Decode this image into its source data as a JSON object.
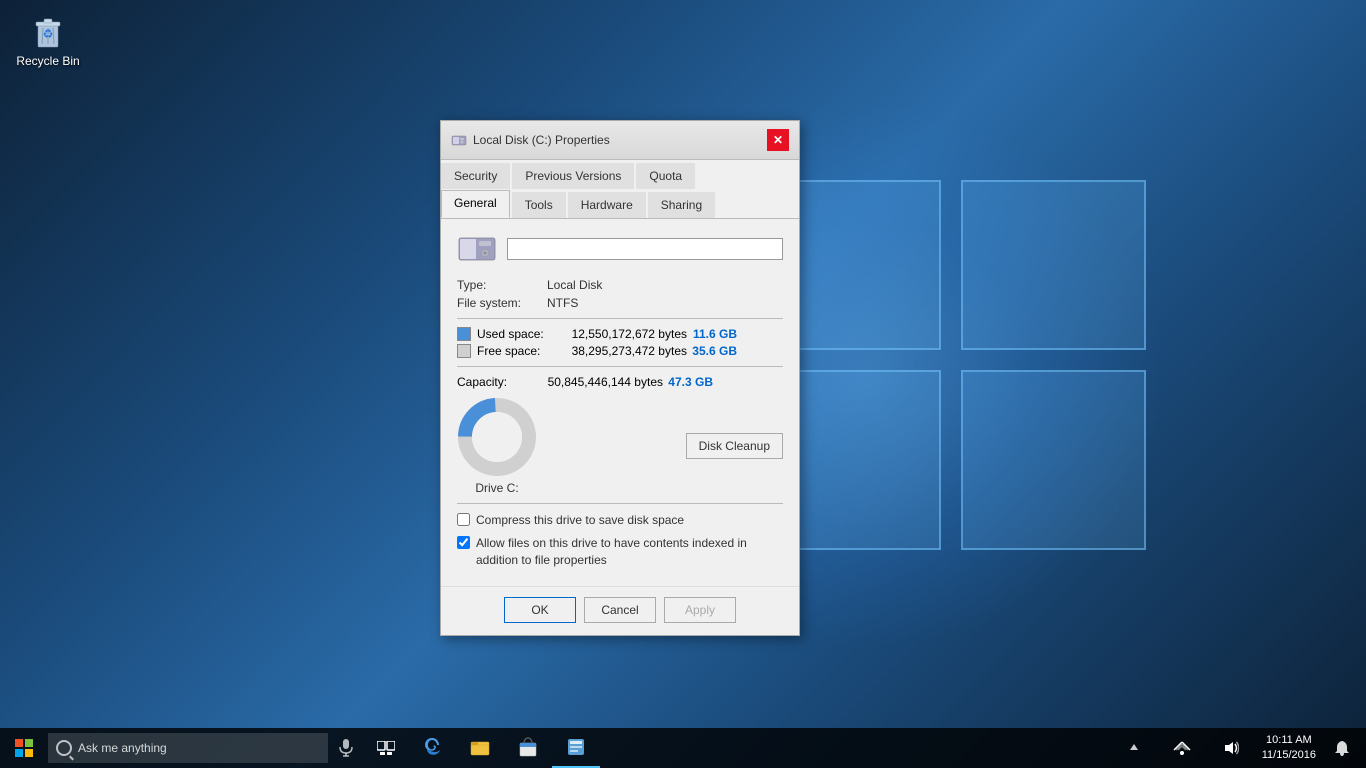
{
  "desktop": {
    "recycle_bin_label": "Recycle Bin"
  },
  "dialog": {
    "title": "Local Disk (C:) Properties",
    "tabs_top": [
      {
        "id": "security",
        "label": "Security"
      },
      {
        "id": "previous_versions",
        "label": "Previous Versions"
      },
      {
        "id": "quota",
        "label": "Quota"
      }
    ],
    "tabs_bottom": [
      {
        "id": "general",
        "label": "General",
        "active": true
      },
      {
        "id": "tools",
        "label": "Tools"
      },
      {
        "id": "hardware",
        "label": "Hardware"
      },
      {
        "id": "sharing",
        "label": "Sharing"
      }
    ],
    "drive_name": "",
    "type_label": "Type:",
    "type_value": "Local Disk",
    "filesystem_label": "File system:",
    "filesystem_value": "NTFS",
    "used_space_label": "Used space:",
    "used_space_bytes": "12,550,172,672 bytes",
    "used_space_gb": "11.6 GB",
    "free_space_label": "Free space:",
    "free_space_bytes": "38,295,273,472 bytes",
    "free_space_gb": "35.6 GB",
    "capacity_label": "Capacity:",
    "capacity_bytes": "50,845,446,144 bytes",
    "capacity_gb": "47.3 GB",
    "drive_label": "Drive C:",
    "disk_cleanup_btn": "Disk Cleanup",
    "compress_label": "Compress this drive to save disk space",
    "index_label": "Allow files on this drive to have contents indexed in addition to file properties",
    "ok_btn": "OK",
    "cancel_btn": "Cancel",
    "apply_btn": "Apply",
    "used_percent": 24,
    "free_percent": 76,
    "used_color": "#4a90d9",
    "free_color": "#d0d0d0"
  },
  "taskbar": {
    "search_placeholder": "Ask me anything",
    "clock_time": "10:11 AM",
    "clock_date": "11/15/2016"
  }
}
